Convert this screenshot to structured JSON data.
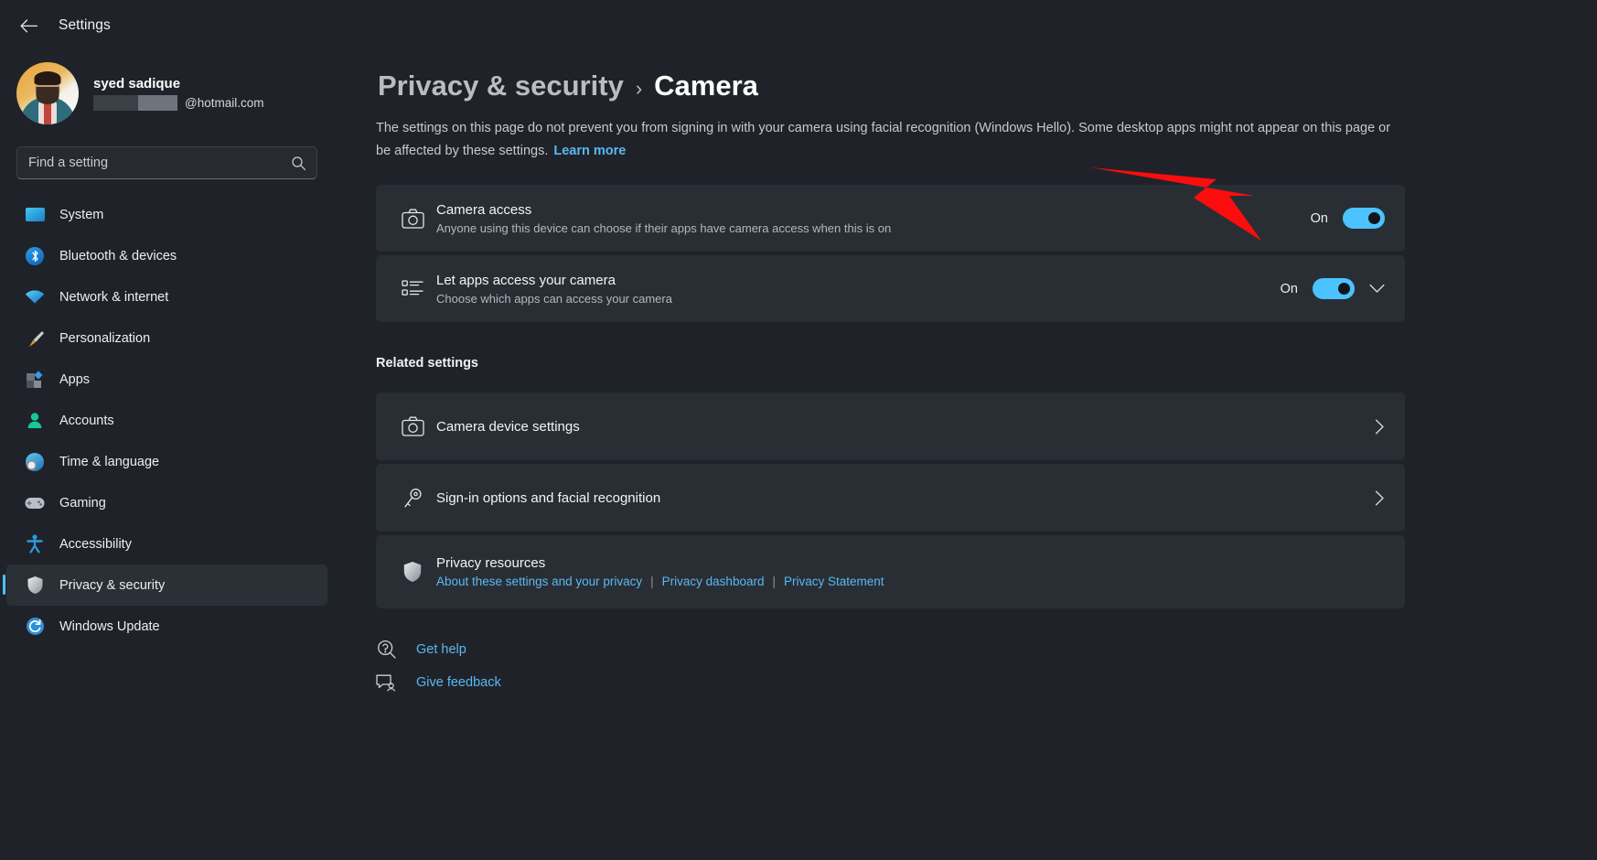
{
  "window": {
    "app_title": "Settings",
    "back_icon": "back-arrow-icon"
  },
  "account": {
    "name": "syed sadique",
    "email_suffix": "@hotmail.com",
    "avatar_alt": "user-avatar"
  },
  "search": {
    "placeholder": "Find a setting",
    "value": "",
    "icon": "search-icon"
  },
  "sidebar": {
    "items": [
      {
        "label": "System",
        "icon": "monitor-icon",
        "selected": false
      },
      {
        "label": "Bluetooth & devices",
        "icon": "bluetooth-icon",
        "selected": false
      },
      {
        "label": "Network & internet",
        "icon": "wifi-icon",
        "selected": false
      },
      {
        "label": "Personalization",
        "icon": "paintbrush-icon",
        "selected": false
      },
      {
        "label": "Apps",
        "icon": "apps-icon",
        "selected": false
      },
      {
        "label": "Accounts",
        "icon": "person-icon",
        "selected": false
      },
      {
        "label": "Time & language",
        "icon": "clock-globe-icon",
        "selected": false
      },
      {
        "label": "Gaming",
        "icon": "gamepad-icon",
        "selected": false
      },
      {
        "label": "Accessibility",
        "icon": "accessibility-icon",
        "selected": false
      },
      {
        "label": "Privacy & security",
        "icon": "shield-icon",
        "selected": true
      },
      {
        "label": "Windows Update",
        "icon": "update-icon",
        "selected": false
      }
    ]
  },
  "breadcrumb": {
    "parent": "Privacy & security",
    "separator": "›",
    "current": "Camera"
  },
  "page": {
    "description": "The settings on this page do not prevent you from signing in with your camera using facial recognition (Windows Hello). Some desktop apps might not appear on this page or be affected by these settings.",
    "learn_more": "Learn more"
  },
  "settings_rows": [
    {
      "title": "Camera access",
      "subtitle": "Anyone using this device can choose if their apps have camera access when this is on",
      "icon": "camera-icon",
      "state_label": "On",
      "toggle_on": true,
      "has_expander": false
    },
    {
      "title": "Let apps access your camera",
      "subtitle": "Choose which apps can access your camera",
      "icon": "app-list-icon",
      "state_label": "On",
      "toggle_on": true,
      "has_expander": true
    }
  ],
  "related": {
    "heading": "Related settings",
    "rows": [
      {
        "title": "Camera device settings",
        "icon": "camera-icon",
        "chevron": "chevron-right-icon"
      },
      {
        "title": "Sign-in options and facial recognition",
        "icon": "key-icon",
        "chevron": "chevron-right-icon"
      }
    ],
    "privacy": {
      "title": "Privacy resources",
      "icon": "shield-icon",
      "links": [
        "About these settings and your privacy",
        "Privacy dashboard",
        "Privacy Statement"
      ],
      "separator": "|"
    }
  },
  "footer": [
    {
      "label": "Get help",
      "icon": "help-icon"
    },
    {
      "label": "Give feedback",
      "icon": "feedback-icon"
    }
  ],
  "colors": {
    "accent": "#4cc2ff",
    "link": "#5bb8f0",
    "annotation_arrow": "#fc0d0d",
    "card_bg": "#292e35",
    "page_bg": "#1f2329"
  },
  "annotation": {
    "shape": "red-arrow",
    "points_to": "Camera access toggle"
  }
}
